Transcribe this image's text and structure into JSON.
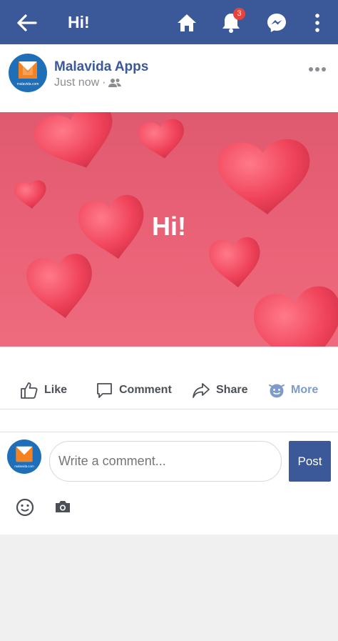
{
  "topbar": {
    "title": "Hi!",
    "notification_count": "3"
  },
  "post": {
    "author": "Malavida Apps",
    "time": "Just now",
    "separator": "·",
    "logo_text": "malavida.com",
    "image_text": "Hi!"
  },
  "actions": {
    "like": "Like",
    "comment": "Comment",
    "share": "Share",
    "more": "More"
  },
  "comment": {
    "placeholder": "Write a comment...",
    "post_label": "Post"
  },
  "colors": {
    "brand": "#3b5998",
    "badge": "#e9423a",
    "image_bg": "#e86175",
    "heart": "#f04359"
  }
}
